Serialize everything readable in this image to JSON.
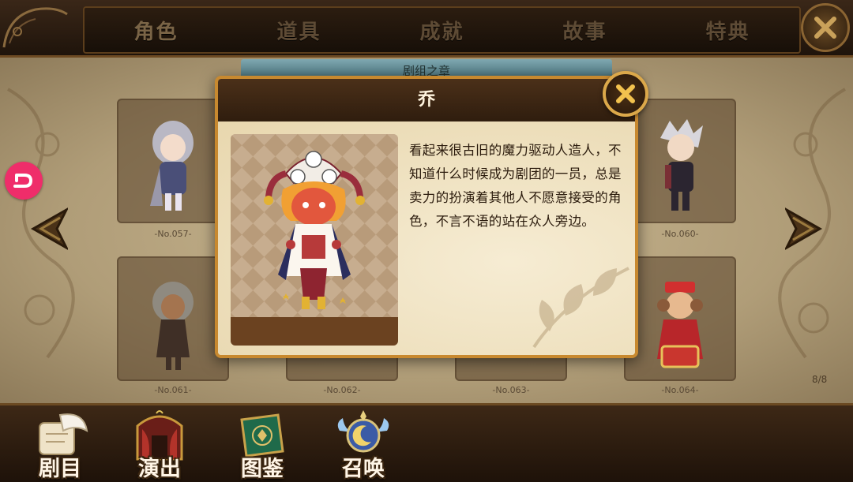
{
  "top_tabs": [
    "角色",
    "道具",
    "成就",
    "故事",
    "特典"
  ],
  "chapter_banner": "剧组之章",
  "cards": [
    {
      "no": "-No.057-"
    },
    {
      "no": "-No.060-"
    },
    {
      "no": "-No.061-"
    },
    {
      "no": "-No.062-"
    },
    {
      "no": "-No.063-"
    },
    {
      "no": "-No.064-"
    }
  ],
  "page_indicator": "8/8",
  "modal": {
    "title": "乔",
    "description": "看起来很古旧的魔力驱动人造人，不知道什么时候成为剧团的一员，总是卖力的扮演着其他人不愿意接受的角色，不言不语的站在众人旁边。"
  },
  "bottom_nav": [
    {
      "label": "剧目",
      "icon": "scroll-quill-icon"
    },
    {
      "label": "演出",
      "icon": "stage-curtain-icon"
    },
    {
      "label": "图鉴",
      "icon": "green-book-icon"
    },
    {
      "label": "召唤",
      "icon": "moon-orb-icon"
    }
  ],
  "colors": {
    "accent_gold": "#dba84a",
    "header_brown": "#3a2718",
    "parchment": "#c9b792",
    "badge_pink": "#ef2d6a"
  }
}
